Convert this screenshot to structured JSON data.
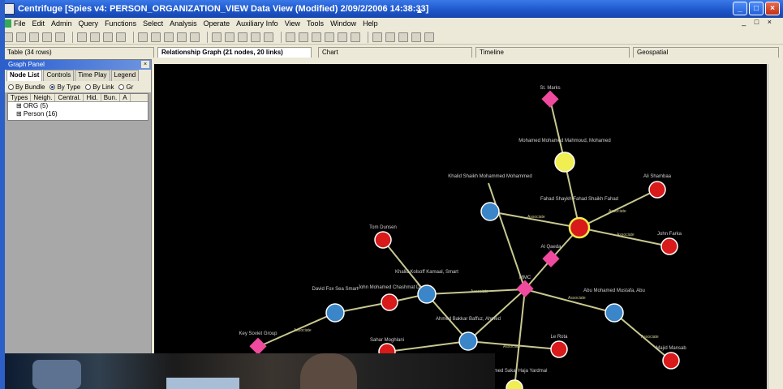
{
  "window": {
    "title": "Centrifuge   [Spies v4: PERSON_ORGANIZATION_VIEW Data View (Modified) 2/09/2/2006 14:38:33]",
    "controls": [
      "_",
      "□",
      "×"
    ]
  },
  "menu": {
    "items": [
      "File",
      "Edit",
      "Admin",
      "Query",
      "Functions",
      "Select",
      "Analysis",
      "Operate",
      "Auxiliary Info",
      "View",
      "Tools",
      "Window",
      "Help"
    ],
    "mdi_controls": "_ □ ×"
  },
  "tabs": [
    {
      "label": "Table (34 rows)"
    },
    {
      "label": "Relationship Graph (21 nodes, 20 links)"
    },
    {
      "label": "Chart"
    },
    {
      "label": "Timeline"
    },
    {
      "label": "Geospatial"
    }
  ],
  "graph_panel": {
    "title": "Graph Panel",
    "close": "×",
    "tabs": [
      "Node List",
      "Controls",
      "Time Play",
      "Legend"
    ],
    "group_options": [
      "By Bundle",
      "By Type",
      "By Link",
      "Gr"
    ],
    "selected_group": "By Type",
    "columns": [
      "Types",
      "Neigh.",
      "Central.",
      "Hid.",
      "Bun.",
      "A"
    ],
    "rows": [
      "⊞ ORG (5)",
      "⊞ Person (16)"
    ]
  },
  "graph": {
    "colors": {
      "background": "#000000",
      "edge": "#c8c890",
      "org": "#f04a9e",
      "person_red": "#d81a1a",
      "person_blue": "#3a86c8",
      "highlight": "#f0ee50"
    },
    "node_labels": [
      "St. Marks",
      "Mohamed Mohamed Mahmoud, Mohamed",
      "Ali Shambaa",
      "Khalid Shaikh Mohammed Mohammed",
      "Fahad Shaykh Fahad Shaikh Fahad",
      "John Farka",
      "Tom Dunsen",
      "Al Qaeda",
      "Khalid Kolsoff Kamaal, Smart",
      "MMC",
      "David Fox Sea Smart",
      "John Mohamed Chashmat D.",
      "Abu Mohamed Mustafa, Abu",
      "Ahmed Bakkar Baffuz, Ahmed",
      "Key Soviet Group",
      "Sahar Moghlani",
      "Le Rota",
      "Majid Mansab",
      "Mohamed Sakal Haja Yardmal"
    ],
    "edge_label": "Associate"
  }
}
